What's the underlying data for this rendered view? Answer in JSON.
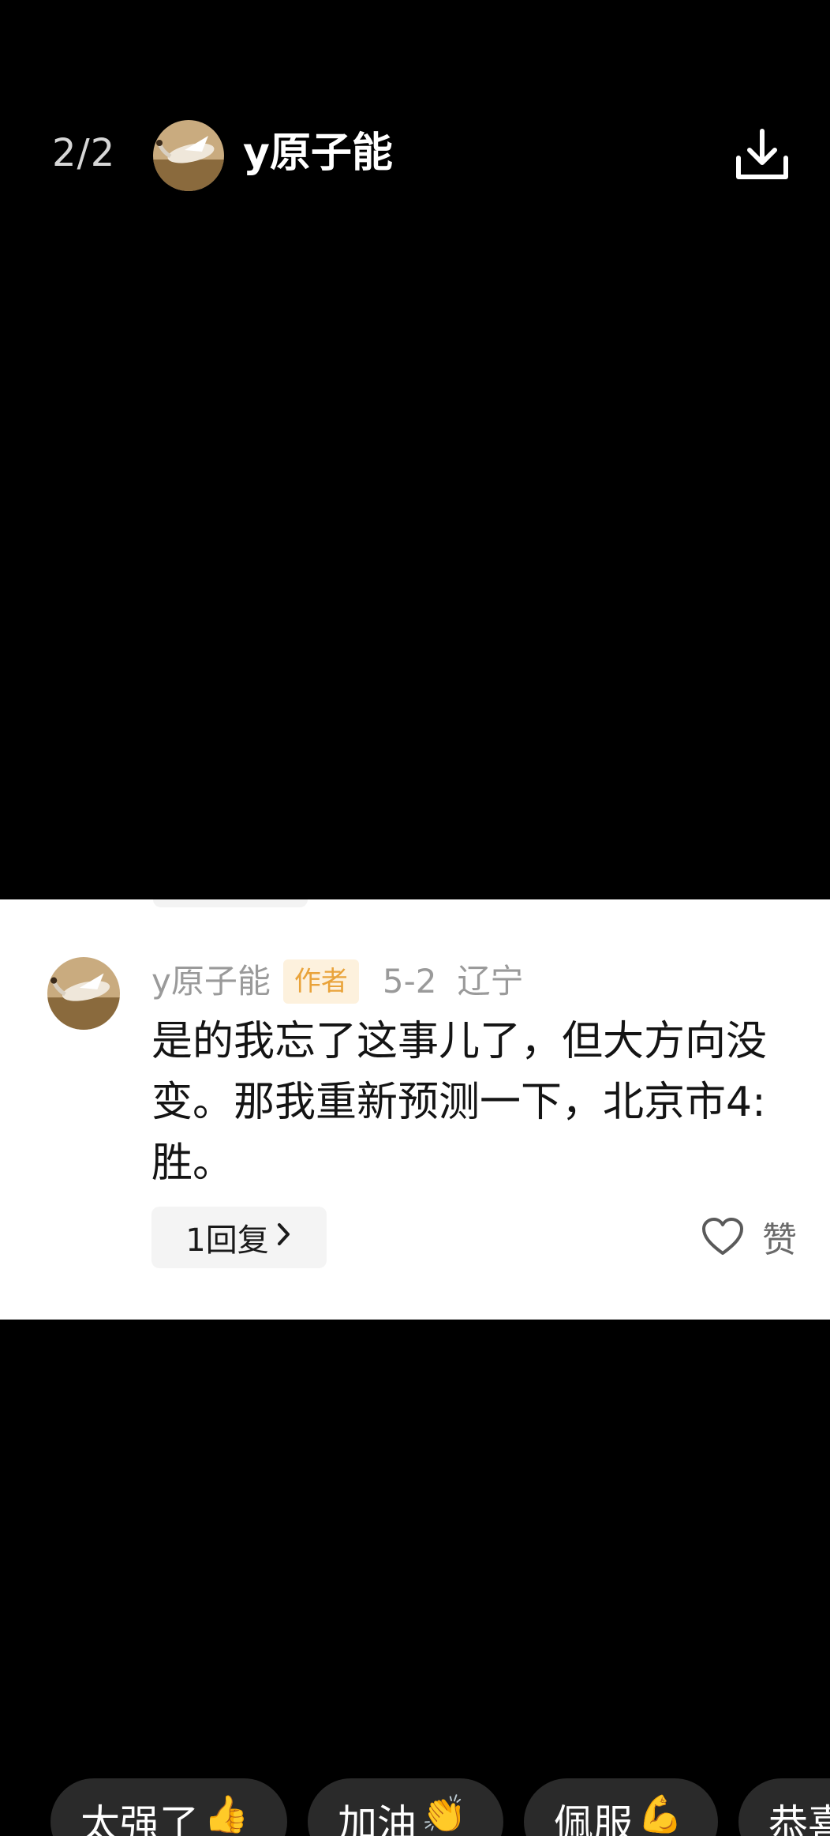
{
  "header": {
    "page_counter": "2/2",
    "username": "y原子能",
    "download_icon": "download-icon"
  },
  "comment": {
    "author": "y原子能",
    "badge": "作者",
    "date": "5-2",
    "location": "辽宁",
    "text": "是的我忘了这事儿了，但大方向没\n变。那我重新预测一下，北京市4:\n胜。",
    "reply_label": "1回复",
    "reply_icon": "chevron-right-icon",
    "like_label": "赞",
    "like_icon": "heart-outline-icon"
  },
  "reactions": [
    {
      "label": "太强了",
      "emoji": "👍"
    },
    {
      "label": "加油",
      "emoji": "👏"
    },
    {
      "label": "佩服",
      "emoji": "💪"
    },
    {
      "label": "恭喜",
      "emoji": ""
    }
  ]
}
